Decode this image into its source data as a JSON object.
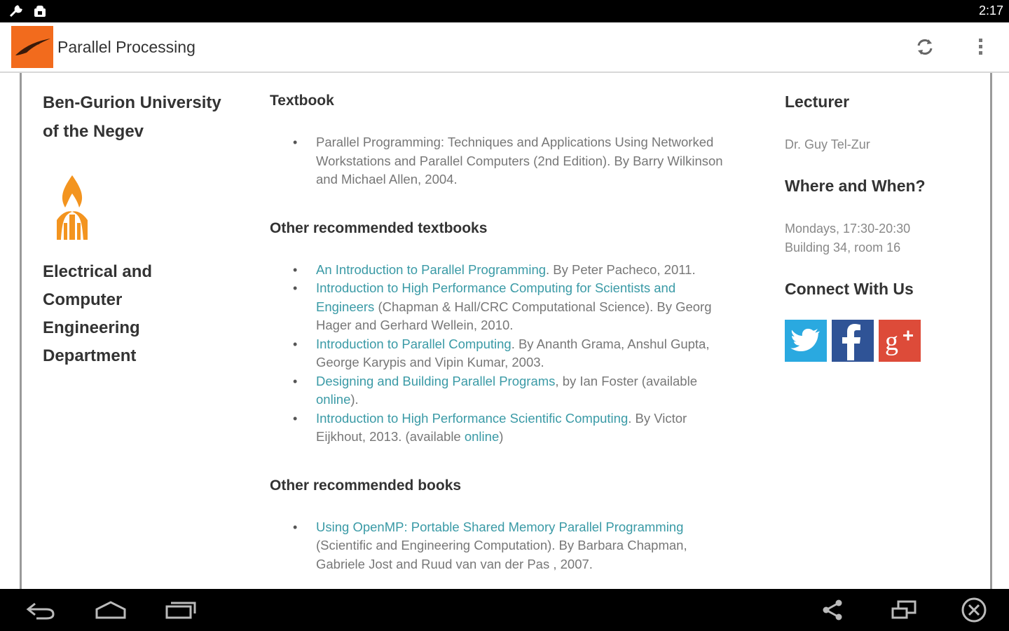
{
  "status_bar": {
    "time": "2:17",
    "icons": [
      "wrench-icon",
      "android-debug-icon"
    ]
  },
  "action_bar": {
    "title": "Parallel Processing",
    "logo_icon": "bird-logo-icon",
    "refresh_icon": "refresh-icon",
    "overflow_icon": "overflow-menu-icon"
  },
  "left": {
    "university": [
      "Ben-Gurion University",
      "of the Negev"
    ],
    "logo_icon": "flame-logo-icon",
    "department": [
      "Electrical and",
      "Computer",
      "Engineering",
      "Department"
    ]
  },
  "middle": {
    "textbook": {
      "heading": "Textbook",
      "items": [
        {
          "text": "Parallel Programming: Techniques and Applications Using Networked Workstations and Parallel Computers (2nd Edition). By Barry Wilkinson and Michael Allen, 2004."
        }
      ]
    },
    "other_textbooks": {
      "heading": "Other recommended textbooks",
      "items": [
        {
          "link": "An Introduction to Parallel Programming",
          "text": ". By Peter Pacheco, 2011."
        },
        {
          "link": "Introduction to High Performance Computing for Scientists and Engineers",
          "text": " (Chapman & Hall/CRC Computational Science). By Georg Hager and Gerhard Wellein, 2010."
        },
        {
          "link": "Introduction to Parallel Computing",
          "text": ". By Ananth Grama, Anshul Gupta, George Karypis and Vipin Kumar, 2003."
        },
        {
          "link": "Designing and Building Parallel Programs",
          "text": ", by Ian Foster (available ",
          "link2": "online",
          "text2": ")."
        },
        {
          "link": "Introduction to High Performance Scientific Computing",
          "text": ". By Victor Eijkhout, 2013. (available ",
          "link2": "online",
          "text2": ")"
        }
      ]
    },
    "other_books": {
      "heading": "Other recommended books",
      "items": [
        {
          "link": "Using OpenMP: Portable Shared Memory Parallel Programming",
          "text": " (Scientific and Engineering Computation). By Barbara Chapman, Gabriele Jost and Ruud van van der Pas , 2007."
        }
      ]
    }
  },
  "right": {
    "lecturer_heading": "Lecturer",
    "lecturer": "Dr. Guy Tel-Zur",
    "where_heading": "Where and When?",
    "when": "Mondays, 17:30-20:30",
    "where": "Building 34, room 16",
    "connect_heading": "Connect With Us",
    "social": [
      "twitter-icon",
      "facebook-icon",
      "google-plus-icon"
    ],
    "colors": {
      "twitter": "#2aa9e0",
      "facebook": "#2f5396",
      "google_plus": "#dd4b39"
    }
  },
  "nav_bar": {
    "icons": [
      "back-icon",
      "home-icon",
      "recent-apps-icon",
      "share-icon",
      "window-icon",
      "close-icon"
    ]
  },
  "colors": {
    "link": "#3a9aa6",
    "logo_orange": "#f26b1d",
    "heading": "#333333",
    "body_text": "#777777"
  }
}
